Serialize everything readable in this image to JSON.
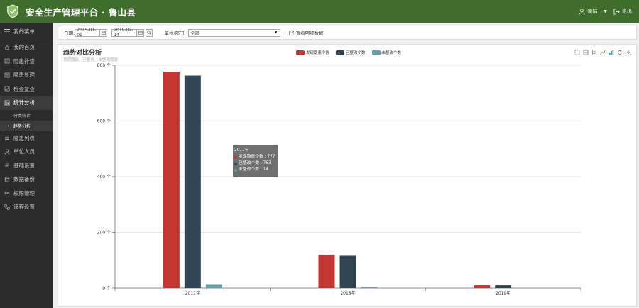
{
  "header": {
    "title": "安全生产管理平台 · 鲁山县",
    "user": "徐娟",
    "logout": "退出"
  },
  "sidebar": {
    "menu_label": "我的菜单",
    "items": [
      {
        "label": "我的首页",
        "icon": "home-icon"
      },
      {
        "label": "隐患排查",
        "icon": "search-list-icon"
      },
      {
        "label": "隐患处理",
        "icon": "check-list-icon"
      },
      {
        "label": "检查复查",
        "icon": "review-icon"
      },
      {
        "label": "统计分析",
        "icon": "chart-icon",
        "active": true
      },
      {
        "label": "隐患列表",
        "icon": "list-icon"
      },
      {
        "label": "单位人员",
        "icon": "person-icon"
      },
      {
        "label": "基础设置",
        "icon": "gear-icon"
      },
      {
        "label": "数据备份",
        "icon": "database-icon"
      },
      {
        "label": "权限管理",
        "icon": "key-icon"
      },
      {
        "label": "流程设置",
        "icon": "flow-icon"
      }
    ],
    "sub_items": [
      {
        "label": "分类统计"
      },
      {
        "label": "趋势分析",
        "active": true
      }
    ]
  },
  "filter": {
    "date_label": "日期:",
    "date_start": "2015-01-01",
    "date_end": "2019-02-14",
    "dept_label": "单位/部门:",
    "dept_value": "全部",
    "detail_link": "查看明细数据"
  },
  "panel": {
    "title": "趋势对比分析",
    "subtitle": "发现隐患、已整改、未整改隐患"
  },
  "tooltip": {
    "title": "2017年",
    "rows": [
      {
        "text": "发现隐患个数 : 777"
      },
      {
        "text": "已整改个数 : 763"
      },
      {
        "text": "未整改个数 : 14"
      }
    ]
  },
  "colors": {
    "header_bg": "#3f6e2c",
    "sidebar_bg": "#2b2b2b",
    "series_found": "#c23531",
    "series_fixed": "#2f4554",
    "series_unfixed": "#61a0a8"
  },
  "chart_data": {
    "type": "bar",
    "categories": [
      "2017年",
      "2018年",
      "2019年"
    ],
    "series": [
      {
        "name": "发现隐患个数",
        "values": [
          777,
          120,
          10
        ]
      },
      {
        "name": "已整改个数",
        "values": [
          763,
          116,
          10
        ]
      },
      {
        "name": "未整改个数",
        "values": [
          14,
          4,
          0
        ]
      }
    ],
    "ylim": [
      0,
      800
    ],
    "yticks": [
      0,
      200,
      400,
      600,
      800
    ],
    "ytick_labels": [
      "0 个",
      "200 个",
      "400 个",
      "600 个",
      "800 个"
    ],
    "grid": true,
    "legend_position": "top-center"
  }
}
